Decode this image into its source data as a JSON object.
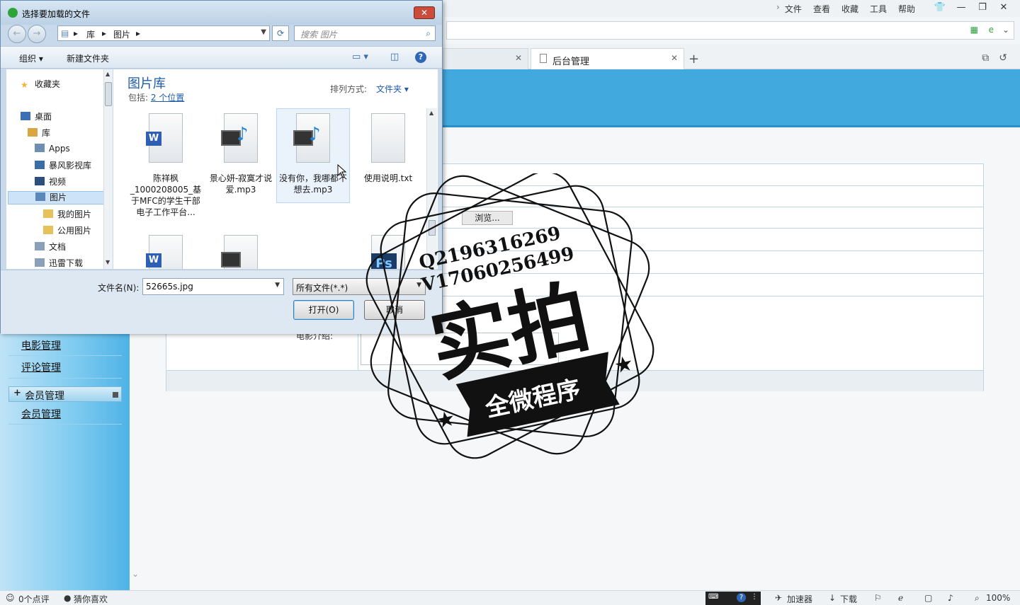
{
  "browser": {
    "menu": [
      "文件",
      "查看",
      "收藏",
      "工具",
      "帮助"
    ],
    "tabs": [
      {
        "label": ""
      },
      {
        "label": "后台管理"
      }
    ],
    "status": {
      "comments": "0个点评",
      "guess": "猜你喜欢",
      "accelerator": "加速器",
      "download": "下载",
      "zoom": "100%"
    }
  },
  "page": {
    "browse_label": "浏览...",
    "movie_intro_label": "电影介绍:",
    "sidebar": {
      "links_top": [
        "电影管理",
        "评论管理"
      ],
      "group_label": "会员管理",
      "group_sign": "+",
      "group_link": "会员管理"
    }
  },
  "dialog": {
    "title": "选择要加载的文件",
    "close_label": "✕",
    "path": [
      "库",
      "图片"
    ],
    "search_placeholder": "搜索 图片",
    "toolbar": {
      "organize": "组织",
      "new_folder": "新建文件夹",
      "help": "?"
    },
    "nav_items": [
      {
        "label": "收藏夹",
        "icon": "star-icon",
        "color": "#f2b52c"
      },
      {
        "label": "桌面",
        "icon": "desktop-icon",
        "color": "#3d6fb6"
      },
      {
        "label": "库",
        "icon": "library-icon",
        "color": "#d9a640"
      },
      {
        "label": "Apps",
        "icon": "apps-icon",
        "color": "#6d8fb4"
      },
      {
        "label": "暴风影视库",
        "icon": "video-library-icon",
        "color": "#3b6ea8"
      },
      {
        "label": "视频",
        "icon": "video-icon",
        "color": "#2c4f7d"
      },
      {
        "label": "图片",
        "icon": "pictures-icon",
        "color": "#5b88b8"
      },
      {
        "label": "我的图片",
        "icon": "folder-icon",
        "color": "#e7c25a"
      },
      {
        "label": "公用图片",
        "icon": "folder-icon",
        "color": "#e7c25a"
      },
      {
        "label": "文档",
        "icon": "documents-icon",
        "color": "#8aa0b8"
      },
      {
        "label": "迅雷下载",
        "icon": "download-folder-icon",
        "color": "#8aa0b8"
      }
    ],
    "library_title": "图片库",
    "includes_prefix": "包括: ",
    "includes_link": "2 个位置",
    "sort_label": "排列方式:",
    "sort_value": "文件夹 ▾",
    "files": [
      {
        "name": "陈祥枫_1000208005_基于MFC的学生干部电子工作平台...",
        "type": "word"
      },
      {
        "name": "景心妍-寂寞才说爱.mp3",
        "type": "media"
      },
      {
        "name": "没有你，我哪都不想去.mp3",
        "type": "media"
      },
      {
        "name": "使用说明.txt",
        "type": "text"
      },
      {
        "name": "",
        "type": "word"
      },
      {
        "name": "",
        "type": "media"
      },
      {
        "name": "",
        "type": "photoshop"
      }
    ],
    "ps_badge": "Ps",
    "word_badge": "W",
    "filename_label": "文件名(N):",
    "filename_value": "52665s.jpg",
    "filetype_value": "所有文件(*.*)",
    "open_label": "打开(O)",
    "cancel_label": "取消"
  },
  "watermark": {
    "qq": "Q2196316269",
    "wechat": "V17060256499",
    "main": "实拍",
    "banner": "全微程序"
  }
}
